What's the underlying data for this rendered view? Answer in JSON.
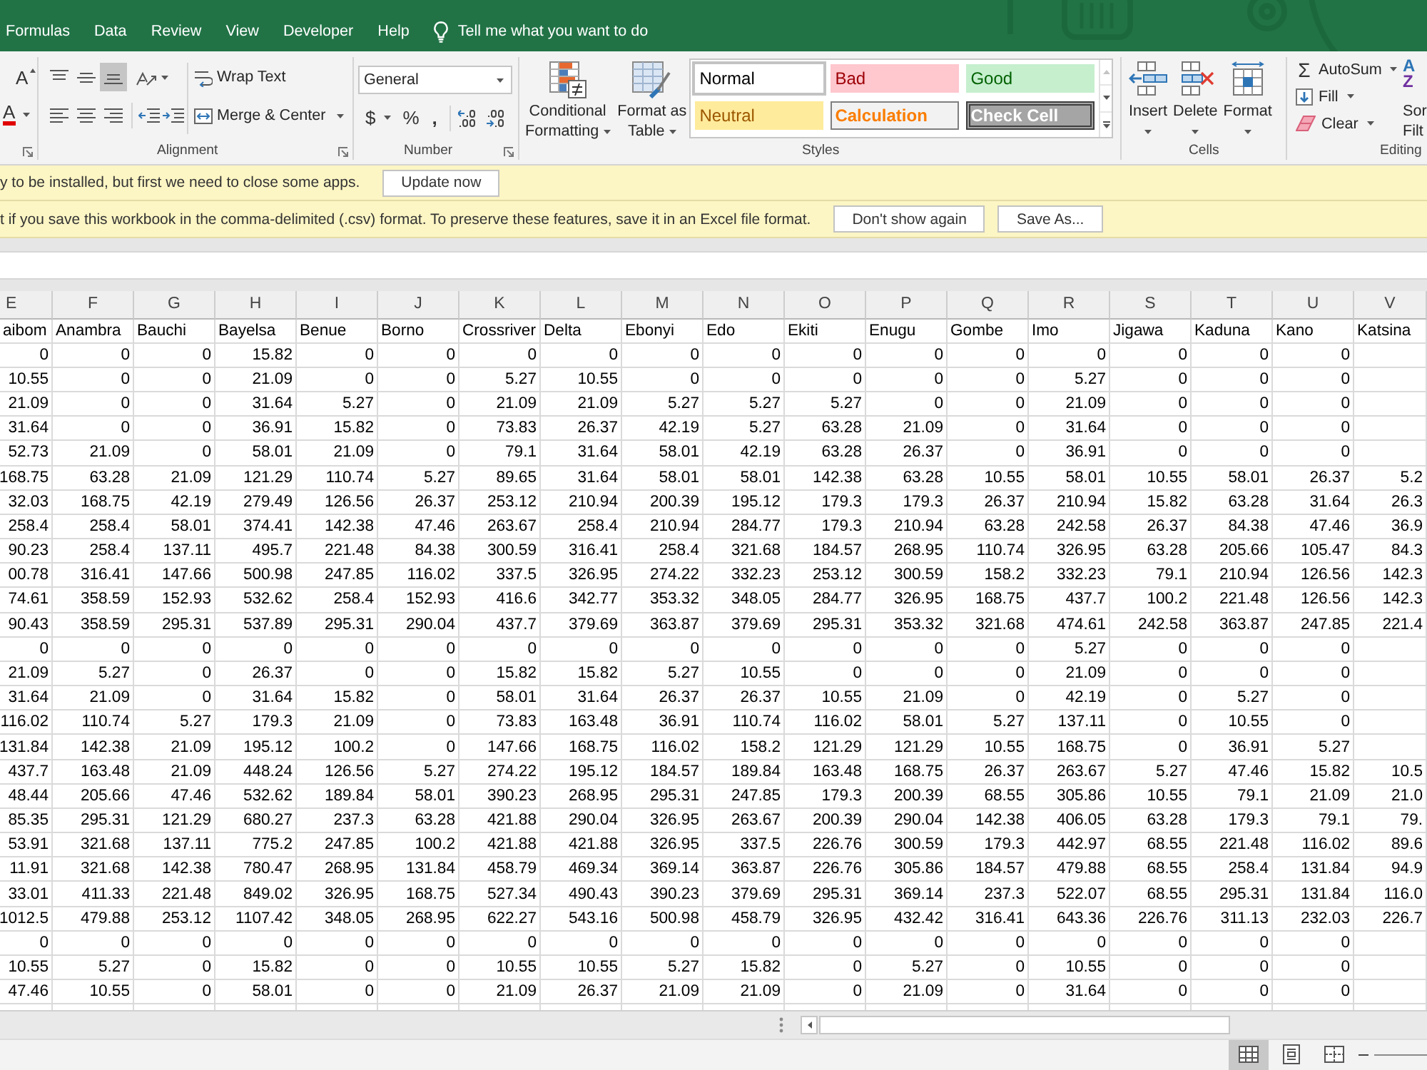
{
  "ribbon_tabs": [
    {
      "label": "Formulas",
      "selected": false
    },
    {
      "label": "Data",
      "selected": false
    },
    {
      "label": "Review",
      "selected": false
    },
    {
      "label": "View",
      "selected": false
    },
    {
      "label": "Developer",
      "selected": false
    },
    {
      "label": "Help",
      "selected": false
    }
  ],
  "tell_me": {
    "placeholder": "Tell me what you want to do"
  },
  "ribbon": {
    "font": {
      "grow_font_glyph": "A",
      "font_color_glyph": "A"
    },
    "alignment": {
      "label": "Alignment",
      "vertical": [
        {
          "kind": "top",
          "selected": false
        },
        {
          "kind": "middle",
          "selected": false
        },
        {
          "kind": "bottom",
          "selected": true
        }
      ],
      "horizontal": [
        {
          "kind": "left",
          "selected": false
        },
        {
          "kind": "center",
          "selected": false
        },
        {
          "kind": "right",
          "selected": false
        }
      ],
      "wrap_text": "Wrap Text",
      "merge": "Merge & Center"
    },
    "number": {
      "label": "Number",
      "format_value": "General",
      "currency": "$",
      "percent": "%",
      "comma": ","
    },
    "styles": {
      "label": "Styles",
      "conditional_formatting": [
        "Conditional",
        "Formatting"
      ],
      "format_as_table": [
        "Format as",
        "Table"
      ],
      "cell_styles": [
        {
          "label": "Normal",
          "kind": "normal",
          "selected": true
        },
        {
          "label": "Bad",
          "kind": "bad",
          "selected": false
        },
        {
          "label": "Good",
          "kind": "good",
          "selected": false
        },
        {
          "label": "Neutral",
          "kind": "neutral",
          "selected": false
        },
        {
          "label": "Calculation",
          "kind": "calculation",
          "selected": false
        },
        {
          "label": "Check Cell",
          "kind": "check",
          "selected": false
        }
      ],
      "gallery_scroll": [
        {
          "kind": "up",
          "disabled": true
        },
        {
          "kind": "down",
          "disabled": false
        },
        {
          "kind": "more",
          "disabled": false
        }
      ]
    },
    "cells": {
      "label": "Cells",
      "buttons": [
        {
          "kind": "insert",
          "label": "Insert"
        },
        {
          "kind": "delete",
          "label": "Delete"
        },
        {
          "kind": "format",
          "label": "Format"
        }
      ]
    },
    "editing": {
      "label": "Editing",
      "commands": [
        {
          "kind": "autosum",
          "glyph": "Σ",
          "label": "AutoSum"
        },
        {
          "kind": "fill",
          "label": "Fill"
        },
        {
          "kind": "clear",
          "label": "Clear"
        }
      ],
      "sort_filter": {
        "glyphs": [
          "A",
          "Z"
        ],
        "label_lines": [
          "Sor",
          "Filt"
        ]
      }
    }
  },
  "notifications": [
    {
      "message": "y to be installed, but first we need to close some apps.",
      "buttons": [
        "Update now"
      ]
    },
    {
      "message": "t if you save this workbook in the comma-delimited (.csv) format. To preserve these features, save it in an Excel file format.",
      "buttons": [
        "Don't show again",
        "Save As..."
      ]
    }
  ],
  "sheet": {
    "column_letters": [
      "E",
      "F",
      "G",
      "H",
      "I",
      "J",
      "K",
      "L",
      "M",
      "N",
      "O",
      "P",
      "Q",
      "R",
      "S",
      "T",
      "U",
      "V"
    ],
    "label_row": [
      "aibom",
      "Anambra",
      "Bauchi",
      "Bayelsa",
      "Benue",
      "Borno",
      "Crossriver",
      "Delta",
      "Ebonyi",
      "Edo",
      "Ekiti",
      "Enugu",
      "Gombe",
      "Imo",
      "Jigawa",
      "Kaduna",
      "Kano",
      "Katsina"
    ],
    "rows": [
      [
        "0",
        "0",
        "0",
        "15.82",
        "0",
        "0",
        "0",
        "0",
        "0",
        "0",
        "0",
        "0",
        "0",
        "0",
        "0",
        "0",
        "0"
      ],
      [
        "10.55",
        "0",
        "0",
        "21.09",
        "0",
        "0",
        "5.27",
        "10.55",
        "0",
        "0",
        "0",
        "0",
        "0",
        "5.27",
        "0",
        "0",
        "0"
      ],
      [
        "21.09",
        "0",
        "0",
        "31.64",
        "5.27",
        "0",
        "21.09",
        "21.09",
        "5.27",
        "5.27",
        "5.27",
        "0",
        "0",
        "21.09",
        "0",
        "0",
        "0"
      ],
      [
        "31.64",
        "0",
        "0",
        "36.91",
        "15.82",
        "0",
        "73.83",
        "26.37",
        "42.19",
        "5.27",
        "63.28",
        "21.09",
        "0",
        "31.64",
        "0",
        "0",
        "0"
      ],
      [
        "52.73",
        "21.09",
        "0",
        "58.01",
        "21.09",
        "0",
        "79.1",
        "31.64",
        "58.01",
        "42.19",
        "63.28",
        "26.37",
        "0",
        "36.91",
        "0",
        "0",
        "0"
      ],
      [
        "168.75",
        "63.28",
        "21.09",
        "121.29",
        "110.74",
        "5.27",
        "89.65",
        "31.64",
        "58.01",
        "58.01",
        "142.38",
        "63.28",
        "10.55",
        "58.01",
        "10.55",
        "58.01",
        "26.37",
        "5.2"
      ],
      [
        "32.03",
        "168.75",
        "42.19",
        "279.49",
        "126.56",
        "26.37",
        "253.12",
        "210.94",
        "200.39",
        "195.12",
        "179.3",
        "179.3",
        "26.37",
        "210.94",
        "15.82",
        "63.28",
        "31.64",
        "26.3"
      ],
      [
        "258.4",
        "258.4",
        "58.01",
        "374.41",
        "142.38",
        "47.46",
        "263.67",
        "258.4",
        "210.94",
        "284.77",
        "179.3",
        "210.94",
        "63.28",
        "242.58",
        "26.37",
        "84.38",
        "47.46",
        "36.9"
      ],
      [
        "90.23",
        "258.4",
        "137.11",
        "495.7",
        "221.48",
        "84.38",
        "300.59",
        "316.41",
        "258.4",
        "321.68",
        "184.57",
        "268.95",
        "110.74",
        "326.95",
        "63.28",
        "205.66",
        "105.47",
        "84.3"
      ],
      [
        "00.78",
        "316.41",
        "147.66",
        "500.98",
        "247.85",
        "116.02",
        "337.5",
        "326.95",
        "274.22",
        "332.23",
        "253.12",
        "300.59",
        "158.2",
        "332.23",
        "79.1",
        "210.94",
        "126.56",
        "142.3"
      ],
      [
        "74.61",
        "358.59",
        "152.93",
        "532.62",
        "258.4",
        "152.93",
        "416.6",
        "342.77",
        "353.32",
        "348.05",
        "284.77",
        "326.95",
        "168.75",
        "437.7",
        "100.2",
        "221.48",
        "126.56",
        "142.3"
      ],
      [
        "90.43",
        "358.59",
        "295.31",
        "537.89",
        "295.31",
        "290.04",
        "437.7",
        "379.69",
        "363.87",
        "379.69",
        "295.31",
        "353.32",
        "321.68",
        "474.61",
        "242.58",
        "363.87",
        "247.85",
        "221.4"
      ],
      [
        "0",
        "0",
        "0",
        "0",
        "0",
        "0",
        "0",
        "0",
        "0",
        "0",
        "0",
        "0",
        "0",
        "5.27",
        "0",
        "0",
        "0"
      ],
      [
        "21.09",
        "5.27",
        "0",
        "26.37",
        "0",
        "0",
        "15.82",
        "15.82",
        "5.27",
        "10.55",
        "0",
        "0",
        "0",
        "21.09",
        "0",
        "0",
        "0"
      ],
      [
        "31.64",
        "21.09",
        "0",
        "31.64",
        "15.82",
        "0",
        "58.01",
        "31.64",
        "26.37",
        "26.37",
        "10.55",
        "21.09",
        "0",
        "42.19",
        "0",
        "5.27",
        "0"
      ],
      [
        "116.02",
        "110.74",
        "5.27",
        "179.3",
        "21.09",
        "0",
        "73.83",
        "163.48",
        "36.91",
        "110.74",
        "116.02",
        "58.01",
        "5.27",
        "137.11",
        "0",
        "10.55",
        "0"
      ],
      [
        "131.84",
        "142.38",
        "21.09",
        "195.12",
        "100.2",
        "0",
        "147.66",
        "168.75",
        "116.02",
        "158.2",
        "121.29",
        "121.29",
        "10.55",
        "168.75",
        "0",
        "36.91",
        "5.27"
      ],
      [
        "437.7",
        "163.48",
        "21.09",
        "448.24",
        "126.56",
        "5.27",
        "274.22",
        "195.12",
        "184.57",
        "189.84",
        "163.48",
        "168.75",
        "26.37",
        "263.67",
        "5.27",
        "47.46",
        "15.82",
        "10.5"
      ],
      [
        "48.44",
        "205.66",
        "47.46",
        "532.62",
        "189.84",
        "58.01",
        "390.23",
        "268.95",
        "295.31",
        "247.85",
        "179.3",
        "200.39",
        "68.55",
        "305.86",
        "10.55",
        "79.1",
        "21.09",
        "21.0"
      ],
      [
        "85.35",
        "295.31",
        "121.29",
        "680.27",
        "237.3",
        "63.28",
        "421.88",
        "290.04",
        "326.95",
        "263.67",
        "200.39",
        "290.04",
        "142.38",
        "406.05",
        "63.28",
        "179.3",
        "79.1",
        "79."
      ],
      [
        "53.91",
        "321.68",
        "137.11",
        "775.2",
        "247.85",
        "100.2",
        "421.88",
        "421.88",
        "326.95",
        "337.5",
        "226.76",
        "300.59",
        "179.3",
        "442.97",
        "68.55",
        "221.48",
        "116.02",
        "89.6"
      ],
      [
        "11.91",
        "321.68",
        "142.38",
        "780.47",
        "268.95",
        "131.84",
        "458.79",
        "469.34",
        "369.14",
        "363.87",
        "226.76",
        "305.86",
        "184.57",
        "479.88",
        "68.55",
        "258.4",
        "131.84",
        "94.9"
      ],
      [
        "33.01",
        "411.33",
        "221.48",
        "849.02",
        "326.95",
        "168.75",
        "527.34",
        "490.43",
        "390.23",
        "379.69",
        "295.31",
        "369.14",
        "237.3",
        "522.07",
        "68.55",
        "295.31",
        "131.84",
        "116.0"
      ],
      [
        "1012.5",
        "479.88",
        "253.12",
        "1107.42",
        "348.05",
        "268.95",
        "622.27",
        "543.16",
        "500.98",
        "458.79",
        "326.95",
        "432.42",
        "316.41",
        "643.36",
        "226.76",
        "311.13",
        "232.03",
        "226.7"
      ],
      [
        "0",
        "0",
        "0",
        "0",
        "0",
        "0",
        "0",
        "0",
        "0",
        "0",
        "0",
        "0",
        "0",
        "0",
        "0",
        "0",
        "0"
      ],
      [
        "10.55",
        "5.27",
        "0",
        "15.82",
        "0",
        "0",
        "10.55",
        "10.55",
        "5.27",
        "15.82",
        "0",
        "5.27",
        "0",
        "10.55",
        "0",
        "0",
        "0"
      ],
      [
        "47.46",
        "10.55",
        "0",
        "58.01",
        "0",
        "0",
        "21.09",
        "26.37",
        "21.09",
        "21.09",
        "0",
        "21.09",
        "0",
        "31.64",
        "0",
        "0",
        "0"
      ]
    ]
  },
  "status_bar": {
    "views": [
      {
        "kind": "normal",
        "selected": true
      },
      {
        "kind": "page-layout",
        "selected": false
      },
      {
        "kind": "page-break",
        "selected": false
      }
    ]
  }
}
